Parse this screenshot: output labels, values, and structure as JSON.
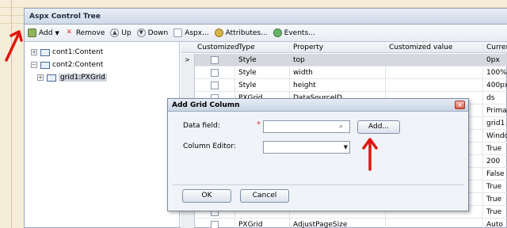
{
  "panel": {
    "title": "Aspx Control Tree"
  },
  "toolbar": {
    "add": "Add",
    "remove": "Remove",
    "up": "Up",
    "down": "Down",
    "aspx": "Aspx...",
    "attributes": "Attributes...",
    "events": "Events..."
  },
  "tree": {
    "nodes": [
      {
        "label": "cont1:Content",
        "expander": "+"
      },
      {
        "label": "cont2:Content",
        "expander": "−"
      },
      {
        "label": "grid1:PXGrid",
        "expander": "+"
      }
    ]
  },
  "grid": {
    "headers": {
      "customized": "Customized",
      "type": "Type",
      "property": "Property",
      "customized_value": "Customized value",
      "current": "Curren"
    },
    "selected_marker": ">",
    "rows": [
      {
        "type": "Style",
        "property": "top",
        "current": "0px"
      },
      {
        "type": "Style",
        "property": "width",
        "current": "100%"
      },
      {
        "type": "Style",
        "property": "height",
        "current": "400px"
      },
      {
        "type": "PXGrid",
        "property": "DataSourceID",
        "current": "ds"
      },
      {
        "type": "",
        "property": "",
        "current": "Primar"
      },
      {
        "type": "",
        "property": "",
        "current": "grid1"
      },
      {
        "type": "",
        "property": "",
        "current": "Windo"
      },
      {
        "type": "",
        "property": "",
        "current": "True"
      },
      {
        "type": "",
        "property": "",
        "current": "200"
      },
      {
        "type": "",
        "property": "",
        "current": "False"
      },
      {
        "type": "",
        "property": "",
        "current": "True"
      },
      {
        "type": "",
        "property": "",
        "current": "True"
      },
      {
        "type": "",
        "property": "",
        "current": "True"
      },
      {
        "type": "PXGrid",
        "property": "AdjustPageSize",
        "current": "Auto"
      }
    ]
  },
  "dialog": {
    "title": "Add Grid Column",
    "close_glyph": "×",
    "data_field_label": "Data field:",
    "required_mark": "*",
    "data_field_value": "",
    "column_editor_label": "Column Editor:",
    "column_editor_value": "",
    "add_button": "Add...",
    "ok_button": "OK",
    "cancel_button": "Cancel"
  },
  "colors": {
    "annotation": "#e0150f",
    "selected_row": "#d5d8dd"
  }
}
